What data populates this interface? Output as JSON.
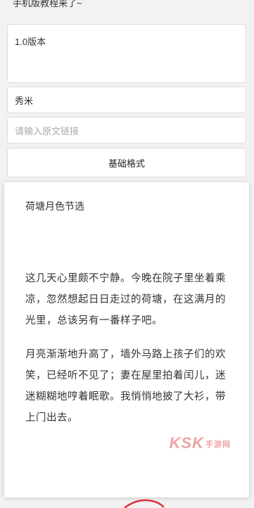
{
  "top_cut_text": "手机版教程来了~",
  "version_text": "1.0版本",
  "author_value": "秀米",
  "link_placeholder": "请输入原文链接",
  "format_button": "基础格式",
  "article": {
    "title": "荷塘月色节选",
    "paragraphs": [
      "这几天心里颇不宁静。今晚在院子里坐着乘凉，忽然想起日日走过的荷塘，在这满月的光里，总该另有一番样子吧。",
      "月亮渐渐地升高了，墙外马路上孩子们的欢笑，已经听不见了；妻在屋里拍着闰儿，迷迷糊糊地哼着眠歌。我悄悄地披了大衫，带上门出去。"
    ]
  },
  "watermark": {
    "logo": "KSK",
    "label": "手游网"
  },
  "colors": {
    "background": "#f2f2f2",
    "watermark": "#e05a5a",
    "annotation": "#e0303a"
  }
}
